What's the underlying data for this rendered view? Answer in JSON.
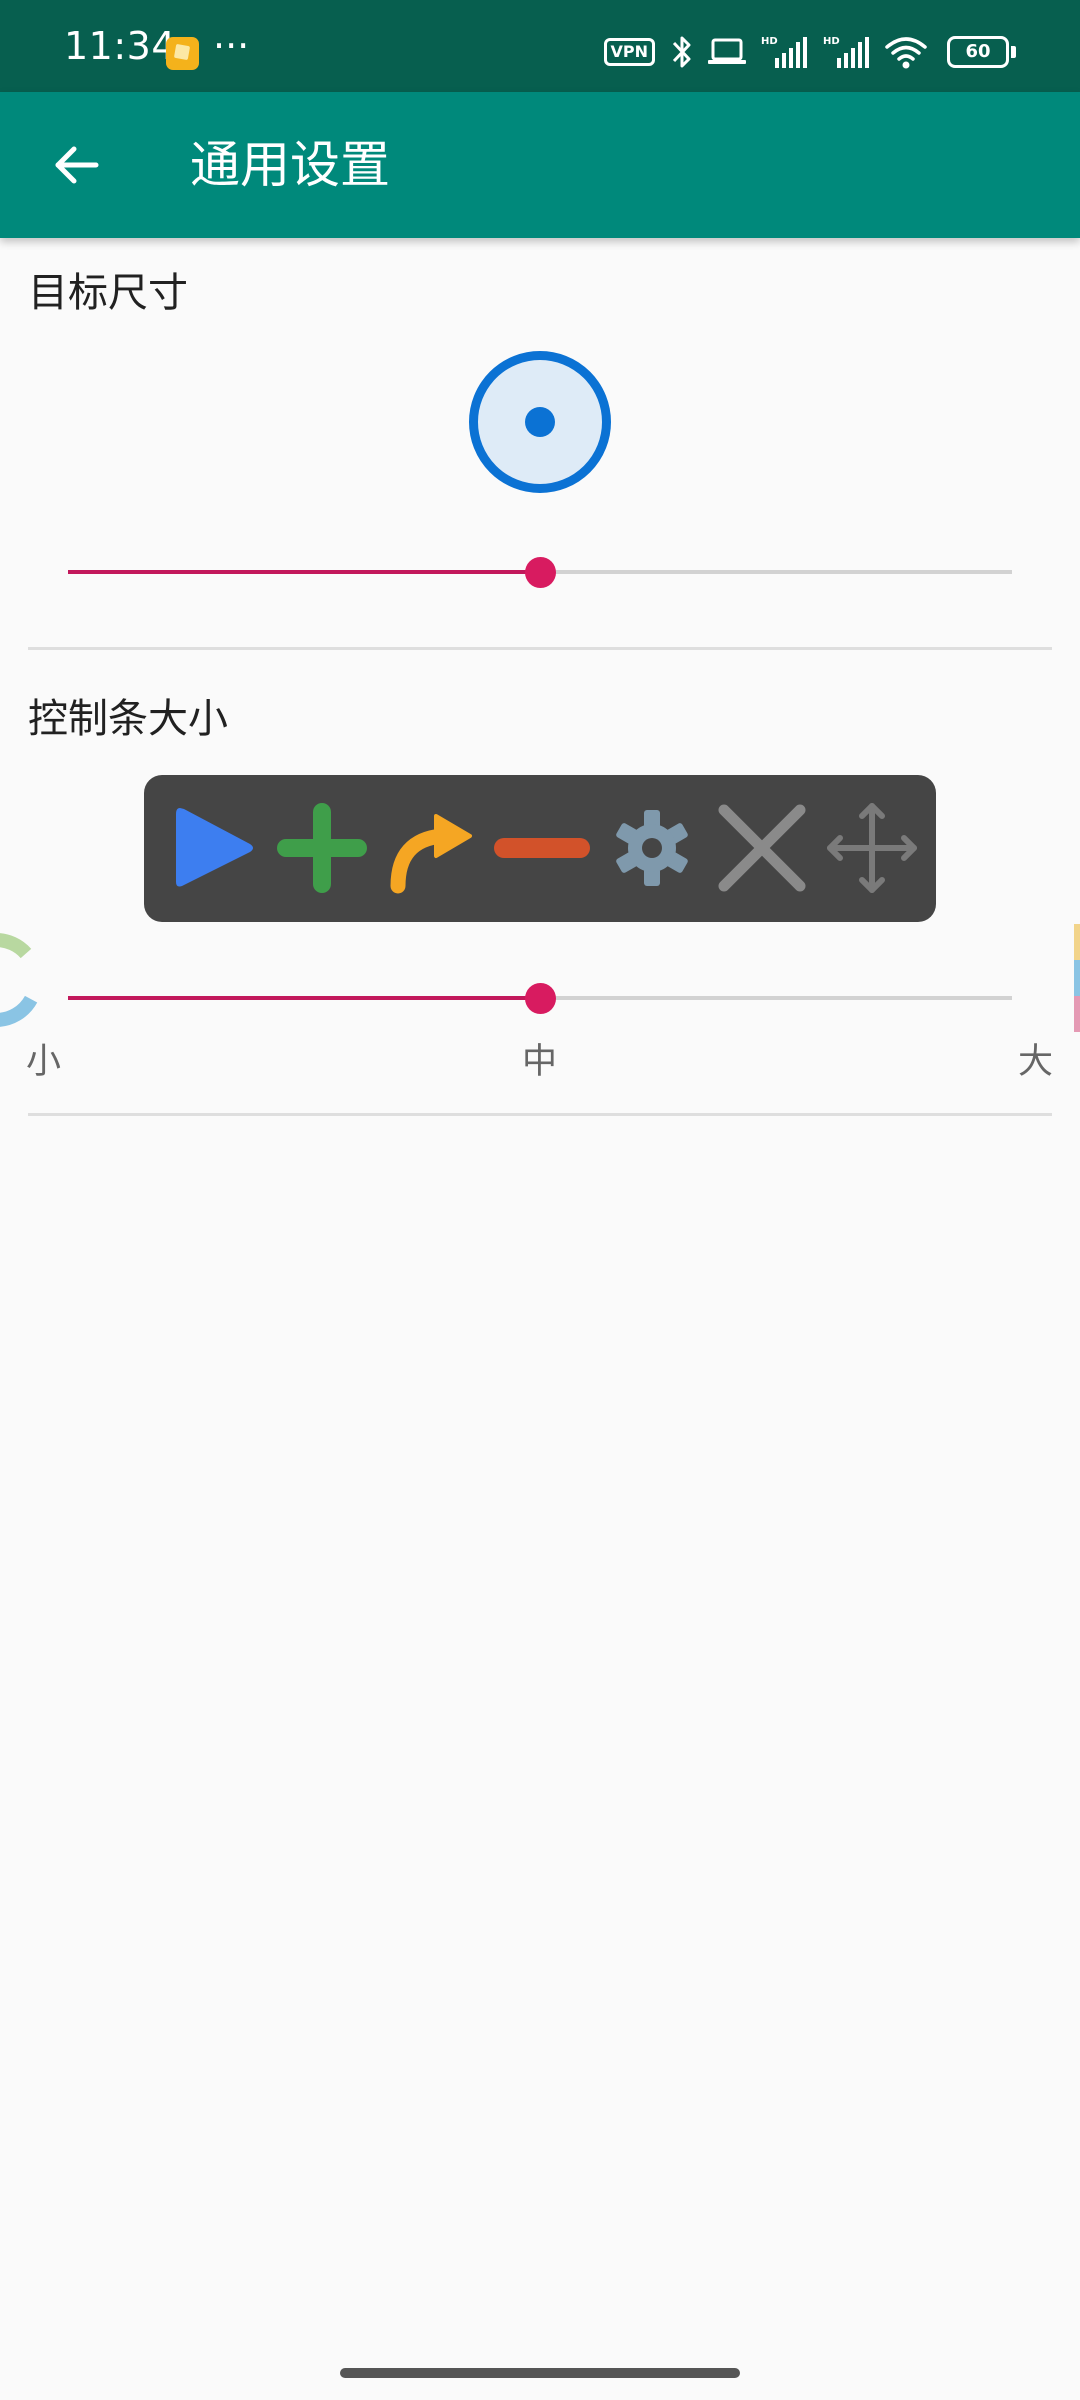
{
  "status_bar": {
    "time": "11:34",
    "more": "···",
    "vpn": "VPN",
    "battery": "60",
    "icons": [
      "app-notification-icon",
      "vpn-icon",
      "bluetooth-icon",
      "laptop-icon",
      "hd-signal-icon",
      "hd-signal-icon",
      "wifi-icon",
      "battery-icon"
    ]
  },
  "app_bar": {
    "title": "通用设置",
    "back_icon": "arrow-back-icon"
  },
  "target_size": {
    "title": "目标尺寸",
    "slider_value": 0.5
  },
  "toolbar_size": {
    "title": "控制条大小",
    "slider_value": 0.5,
    "labels": {
      "small": "小",
      "medium": "中",
      "large": "大"
    },
    "preview_icons": [
      "play-icon",
      "plus-icon",
      "redo-arrow-icon",
      "minus-icon",
      "settings-gear-icon",
      "close-icon",
      "move-icon"
    ]
  },
  "colors": {
    "status_bar": "#075f4f",
    "app_bar": "#00897b",
    "slider_accent": "#d81b60",
    "target_blue": "#0b72d4",
    "toolbar_bg": "#454545"
  }
}
